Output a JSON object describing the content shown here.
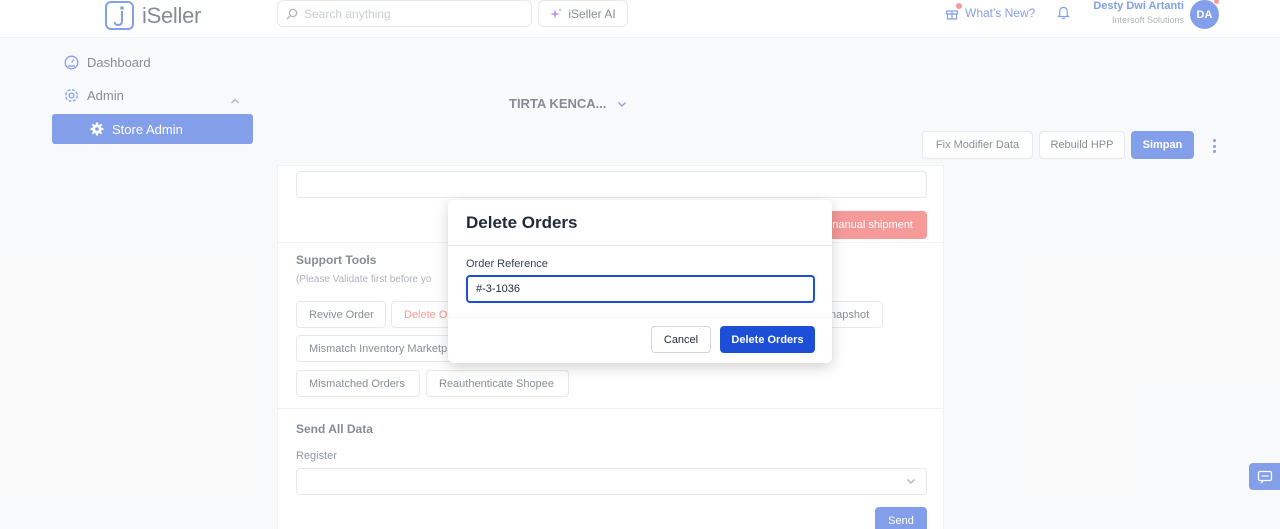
{
  "brand": {
    "name": "iSeller"
  },
  "header": {
    "search_placeholder": "Search anything",
    "ai_label": "iSeller AI",
    "whats_new": "What's New?",
    "user_name": "Desty Dwi Artanti",
    "user_company": "Intersoft Solutions",
    "user_initials": "DA"
  },
  "sidebar": {
    "items": [
      {
        "label": "Dashboard",
        "icon": "dashboard-icon"
      },
      {
        "label": "Admin",
        "icon": "admin-icon"
      },
      {
        "label": "Store Admin",
        "icon": "gear-icon"
      }
    ]
  },
  "store": {
    "name": "TIRTA KENCA...",
    "actions": {
      "fix_modifier": "Fix Modifier Data",
      "rebuild_hpp": "Rebuild HPP",
      "save": "Simpan"
    }
  },
  "content": {
    "manual_shipment_label": "nanual shipment",
    "support_tools": {
      "title": "Support Tools",
      "subtitle": "(Please Validate first before yo",
      "buttons": [
        "Revive Order",
        "Delete O",
        "napshot",
        "Mismatch Inventory Marketp",
        "Mismatched Orders",
        "Reauthenticate Shopee"
      ]
    },
    "send_all": {
      "title": "Send All Data",
      "register_label": "Register",
      "send_label": "Send"
    }
  },
  "modal": {
    "title": "Delete Orders",
    "field_label": "Order Reference",
    "field_value": "#-3-1036",
    "cancel_label": "Cancel",
    "confirm_label": "Delete Orders"
  },
  "colors": {
    "primary": "#1d4ed8",
    "danger": "#ef4444"
  }
}
